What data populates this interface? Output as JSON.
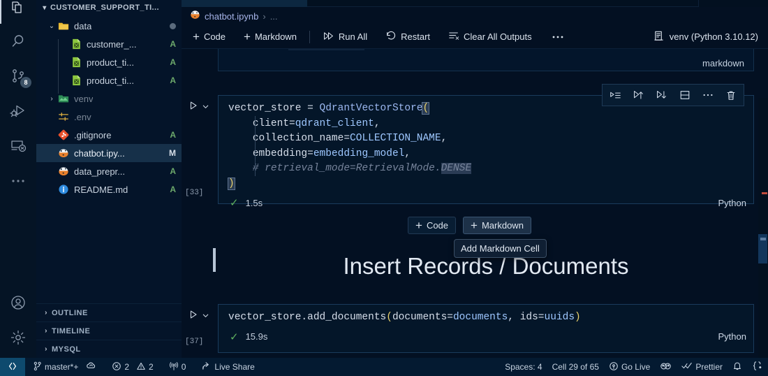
{
  "activity_bar": {
    "items": [
      {
        "name": "explorer",
        "icon": "files-icon",
        "active": true,
        "badge": null
      },
      {
        "name": "search",
        "icon": "search-icon",
        "active": false,
        "badge": null
      },
      {
        "name": "source-control",
        "icon": "source-control-icon",
        "active": false,
        "badge": "8"
      },
      {
        "name": "run-and-debug",
        "icon": "run-debug-icon",
        "active": false,
        "badge": null
      },
      {
        "name": "remote-explorer",
        "icon": "remote-explorer-icon",
        "active": false,
        "badge": null
      },
      {
        "name": "additional-views",
        "icon": "ellipsis-icon",
        "active": false,
        "badge": null
      }
    ],
    "bottom_items": [
      {
        "name": "accounts",
        "icon": "account-icon"
      },
      {
        "name": "manage",
        "icon": "gear-icon"
      }
    ]
  },
  "sidebar": {
    "explorer_title": "CUSTOMER_SUPPORT_TI...",
    "tree": [
      {
        "label": "data",
        "icon": "folder-open-icon",
        "indent": 1,
        "twisty": "down",
        "status": "",
        "unstaged": true,
        "dim": false,
        "selected": false
      },
      {
        "label": "customer_...",
        "icon": "csv-icon",
        "indent": 2,
        "twisty": "",
        "status": "A",
        "unstaged": false,
        "dim": false,
        "selected": false
      },
      {
        "label": "product_ti...",
        "icon": "csv-icon",
        "indent": 2,
        "twisty": "",
        "status": "A",
        "unstaged": false,
        "dim": false,
        "selected": false
      },
      {
        "label": "product_ti...",
        "icon": "csv-icon",
        "indent": 2,
        "twisty": "",
        "status": "A",
        "unstaged": false,
        "dim": false,
        "selected": false
      },
      {
        "label": "venv",
        "icon": "folder-icon",
        "indent": 1,
        "twisty": "right",
        "status": "",
        "unstaged": false,
        "dim": true,
        "selected": false
      },
      {
        "label": ".env",
        "icon": "settings-file-icon",
        "indent": 1,
        "twisty": "",
        "status": "",
        "unstaged": false,
        "dim": true,
        "selected": false
      },
      {
        "label": ".gitignore",
        "icon": "git-icon",
        "indent": 1,
        "twisty": "",
        "status": "A",
        "unstaged": false,
        "dim": false,
        "selected": false
      },
      {
        "label": "chatbot.ipy...",
        "icon": "notebook-icon",
        "indent": 1,
        "twisty": "",
        "status": "M",
        "unstaged": false,
        "dim": false,
        "selected": true
      },
      {
        "label": "data_prepr...",
        "icon": "notebook-icon",
        "indent": 1,
        "twisty": "",
        "status": "A",
        "unstaged": false,
        "dim": false,
        "selected": false
      },
      {
        "label": "README.md",
        "icon": "info-icon",
        "indent": 1,
        "twisty": "",
        "status": "A",
        "unstaged": false,
        "dim": false,
        "selected": false
      }
    ],
    "panels": [
      {
        "label": "OUTLINE"
      },
      {
        "label": "TIMELINE"
      },
      {
        "label": "MYSQL"
      }
    ]
  },
  "editor": {
    "breadcrumb": {
      "file": "chatbot.ipynb",
      "separator": "›",
      "overflow": "..."
    },
    "toolbar": {
      "add_code_label": "Code",
      "add_markdown_label": "Markdown",
      "run_all_label": "Run All",
      "restart_label": "Restart",
      "clear_outputs_label": "Clear All Outputs",
      "more_label": "···",
      "kernel_label": "venv (Python 3.10.12)"
    },
    "cut_cell": {
      "text": "hybrid_search",
      "lang_label": "markdown"
    },
    "cell_actions": [
      {
        "name": "run-by-line-button",
        "icon": "run-by-line-icon"
      },
      {
        "name": "execute-above-button",
        "icon": "execute-above-icon"
      },
      {
        "name": "execute-below-button",
        "icon": "execute-below-icon"
      },
      {
        "name": "split-cell-button",
        "icon": "split-cell-icon"
      },
      {
        "name": "more-actions-button",
        "icon": "ellipsis-icon"
      },
      {
        "name": "delete-cell-button",
        "icon": "trash-icon"
      }
    ],
    "cells": [
      {
        "exec_count": "[33]",
        "duration": "1.5s",
        "lang": "Python",
        "status": "success"
      },
      {
        "exec_count": "[37]",
        "duration": "15.9s",
        "lang": "Python",
        "status": "success"
      }
    ],
    "code_cell_1_lines": [
      "vector_store = QdrantVectorStore(",
      "    client=qdrant_client,",
      "    collection_name=COLLECTION_NAME,",
      "    embedding=embedding_model,",
      "    # retrieval_mode=RetrievalMode.DENSE",
      ")"
    ],
    "code_cell_2_lines": [
      "vector_store.add_documents(documents=documents, ids=uuids)"
    ],
    "markdown_heading": "Insert Records / Documents",
    "insert_bar": {
      "code_label": "Code",
      "markdown_label": "Markdown",
      "tooltip": "Add Markdown Cell"
    }
  },
  "statusbar": {
    "remote_icon": "remote-window-icon",
    "branch": "master*+",
    "sync_icon": "sync-cloud-icon",
    "errors": "2",
    "warnings": "2",
    "ports": "0",
    "live_share": "Live Share",
    "spaces": "Spaces: 4",
    "cell_position": "Cell 29 of 65",
    "go_live": "Go Live",
    "prettier": "Prettier",
    "bell_icon": "bell-icon",
    "brackets_icon": "brackets-icon",
    "gitlens_icon": "gitlens-icon"
  },
  "colors": {
    "background": "#031022",
    "sidebar": "#041429",
    "selection": "#163049",
    "accent": "#0e4a6e",
    "added": "#6da96b",
    "modified": "#d5dde6",
    "success": "#5fb05f"
  }
}
